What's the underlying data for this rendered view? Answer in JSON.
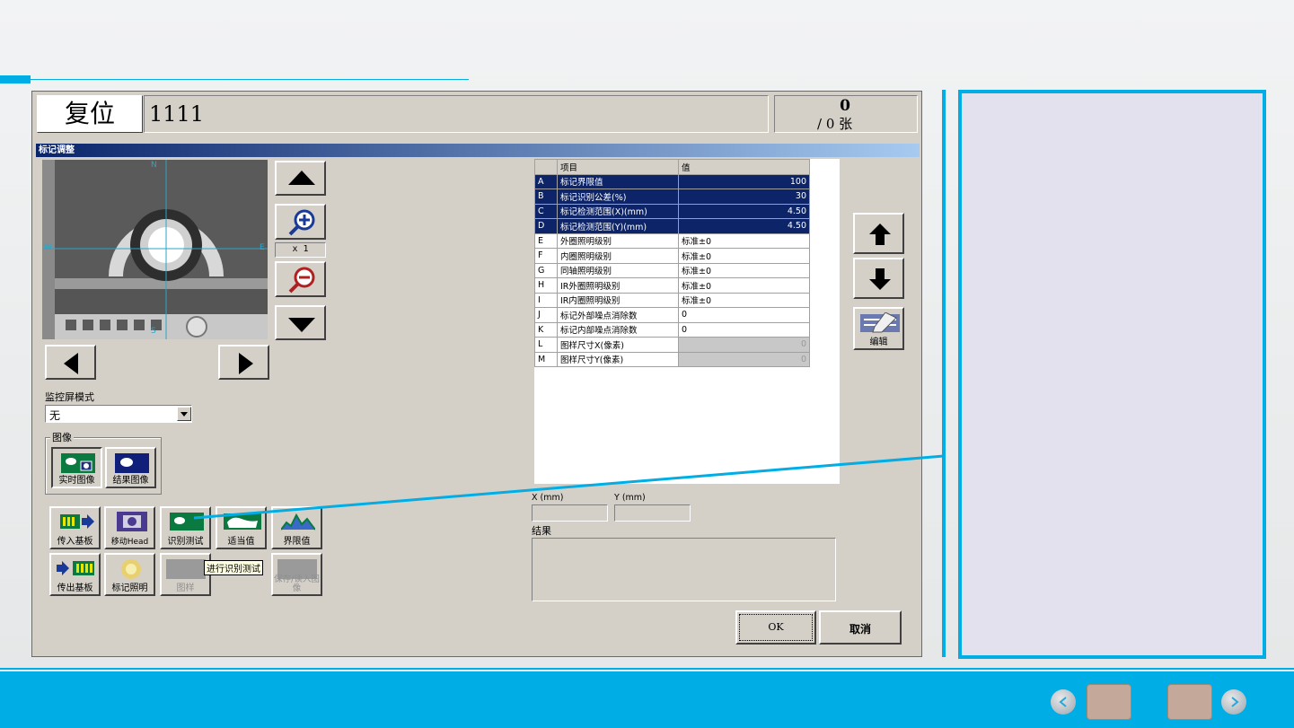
{
  "header": {
    "mode": "复位",
    "program_id": "1111",
    "count_top": "0",
    "count_bottom": "/ 0 张"
  },
  "dialog": {
    "title": "标记调整",
    "zoom": "x 1",
    "compass": {
      "n": "N",
      "s": "S",
      "w": "W",
      "e": "E"
    },
    "monitor_mode_label": "监控屏模式",
    "monitor_mode_value": "无",
    "image_group_label": "图像",
    "image_buttons": {
      "live": "实时图像",
      "result": "结果图像"
    },
    "func_buttons": {
      "load": "传入基板",
      "move_head": "移动Head",
      "recog_test": "识别测试",
      "proper": "适当值",
      "limit": "界限值",
      "unload": "传出基板",
      "mark_light": "标记照明",
      "pattern": "图样",
      "save_load": "保存/读入图像"
    },
    "tooltip": "进行识别测试",
    "edit_label": "编辑",
    "table": {
      "headers": [
        "",
        "项目",
        "值"
      ],
      "rows": [
        [
          "A",
          "标记界限值",
          "100"
        ],
        [
          "B",
          "标记识别公差(%)",
          "30"
        ],
        [
          "C",
          "标记检测范围(X)(mm)",
          "4.50"
        ],
        [
          "D",
          "标记检测范围(Y)(mm)",
          "4.50"
        ],
        [
          "E",
          "外圈照明级别",
          "标准±0"
        ],
        [
          "F",
          "内圈照明级别",
          "标准±0"
        ],
        [
          "G",
          "同轴照明级别",
          "标准±0"
        ],
        [
          "H",
          "IR外圈照明级别",
          "标准±0"
        ],
        [
          "I",
          "IR内圈照明级别",
          "标准±0"
        ],
        [
          "J",
          "标记外部噪点消除数",
          "0"
        ],
        [
          "K",
          "标记内部噪点消除数",
          "0"
        ],
        [
          "L",
          "图样尺寸X(像素)",
          "0"
        ],
        [
          "M",
          "图样尺寸Y(像素)",
          "0"
        ]
      ]
    },
    "x_label": "X (mm)",
    "y_label": "Y (mm)",
    "x_value": "",
    "y_value": "",
    "result_label": "结果",
    "ok": "OK",
    "cancel": "取消"
  },
  "colors": {
    "accent": "#00aee5",
    "selected_row": "#0d2468",
    "panel": "#d4d0c8"
  },
  "icons": [
    "up-arrow-icon",
    "down-arrow-icon",
    "left-arrow-icon",
    "right-arrow-icon",
    "zoom-in-icon",
    "zoom-out-icon",
    "scroll-up-icon",
    "scroll-down-icon",
    "edit-icon",
    "previous-icon",
    "next-icon"
  ]
}
